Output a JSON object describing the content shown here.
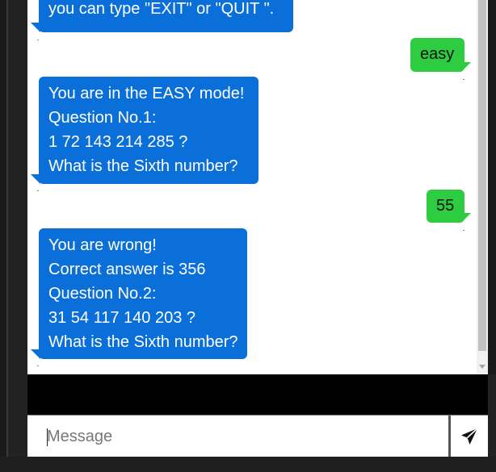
{
  "messages": [
    {
      "sender": "bot",
      "lines": [
        "you can type \"EXIT\" or \"QUIT \"."
      ]
    },
    {
      "sender": "user",
      "lines": [
        "easy"
      ]
    },
    {
      "sender": "bot",
      "lines": [
        "You are in the EASY mode!",
        "Question No.1:",
        "1 72 143 214 285 ?",
        "What is the Sixth number?"
      ]
    },
    {
      "sender": "user",
      "lines": [
        "55"
      ]
    },
    {
      "sender": "bot",
      "lines": [
        "You are wrong!",
        "Correct answer is 356",
        "Question No.2:",
        "31 54 117 140 203 ?",
        "What is the Sixth number?"
      ]
    }
  ],
  "composer": {
    "placeholder": "Message",
    "send_icon": "paper-plane-icon"
  },
  "colors": {
    "bot_bubble": "#0a6fd8",
    "user_bubble": "#2ecc40"
  }
}
